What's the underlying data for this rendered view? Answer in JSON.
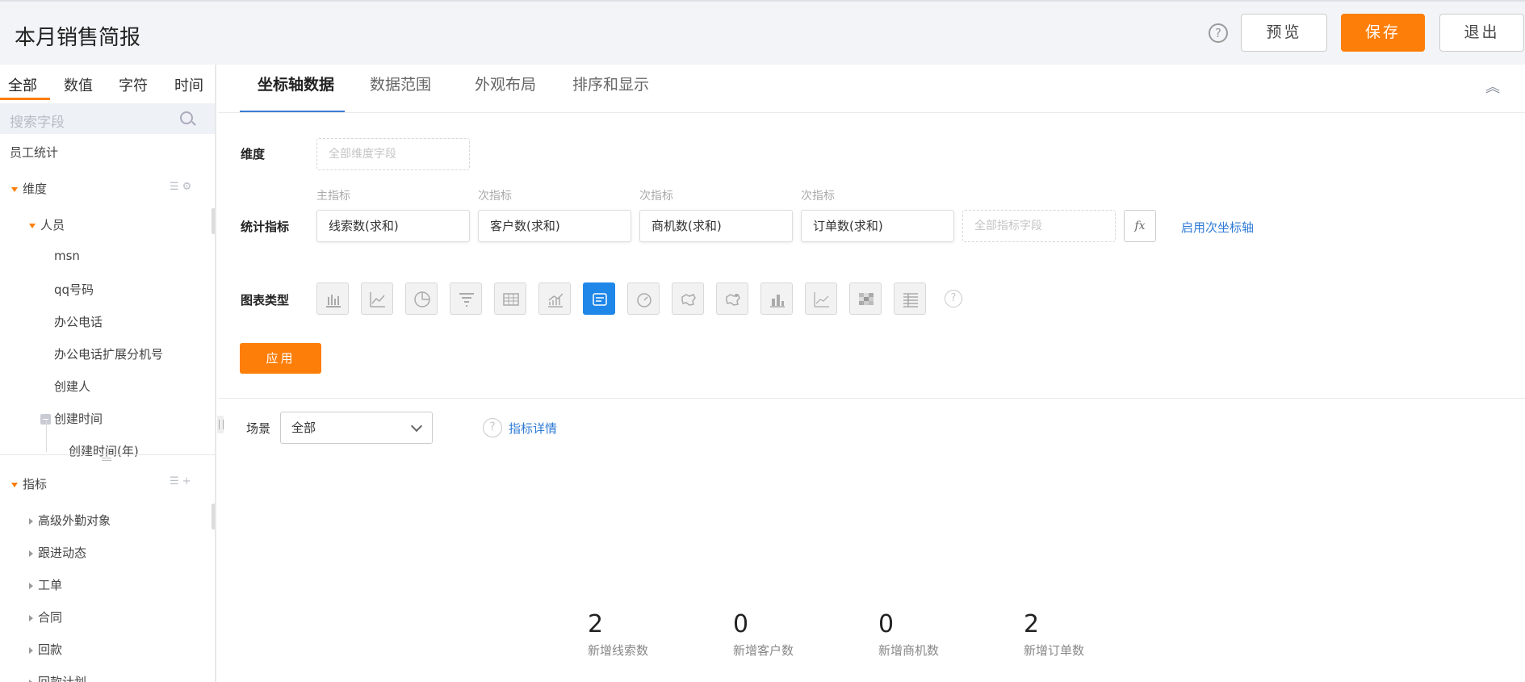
{
  "header": {
    "title": "本月销售简报",
    "help": "?",
    "preview": "预览",
    "save": "保存",
    "exit": "退出"
  },
  "sidebar": {
    "tabs": [
      "全部",
      "数值",
      "字符",
      "时间"
    ],
    "search_placeholder": "搜索字段",
    "dataset": "员工统计",
    "dimension_group": "维度",
    "person_group": "人员",
    "person_fields": [
      "msn",
      "qq号码",
      "办公电话",
      "办公电话扩展分机号",
      "创建人"
    ],
    "created_time": "创建时间",
    "created_time_year": "创建时间(年)",
    "measure_group": "指标",
    "measure_items": [
      "高级外勤对象",
      "跟进动态",
      "工单",
      "合同",
      "回款",
      "回款计划"
    ]
  },
  "main": {
    "tabs": [
      "坐标轴数据",
      "数据范围",
      "外观布局",
      "排序和显示"
    ],
    "dimension_label": "维度",
    "dimension_placeholder": "全部维度字段",
    "metric_label": "统计指标",
    "metric_sublabels": [
      "主指标",
      "次指标",
      "次指标",
      "次指标"
    ],
    "metrics": [
      "线索数(求和)",
      "客户数(求和)",
      "商机数(求和)",
      "订单数(求和)"
    ],
    "metric_placeholder": "全部指标字段",
    "fx": "fx",
    "secondary_axis": "启用次坐标轴",
    "chart_type_label": "图表类型",
    "chart_types": [
      "bar-chart-icon",
      "line-chart-icon",
      "pie-chart-icon",
      "funnel-chart-icon",
      "table-chart-icon",
      "area-chart-icon",
      "kpi-card-icon",
      "gauge-chart-icon",
      "map-chart-icon",
      "world-map-icon",
      "column-chart-icon",
      "scatter-chart-icon",
      "heatmap-chart-icon",
      "pivot-table-icon"
    ],
    "active_chart_type": "kpi-card-icon",
    "apply": "应用",
    "scene_label": "场景",
    "scene_value": "全部",
    "detail_link": "指标详情",
    "kpis": [
      {
        "value": "2",
        "label": "新增线索数"
      },
      {
        "value": "0",
        "label": "新增客户数"
      },
      {
        "value": "0",
        "label": "新增商机数"
      },
      {
        "value": "2",
        "label": "新增订单数"
      }
    ]
  },
  "colors": {
    "accent": "#fd7e08",
    "link": "#2d7ad6",
    "active_chart": "#1f87e8"
  }
}
